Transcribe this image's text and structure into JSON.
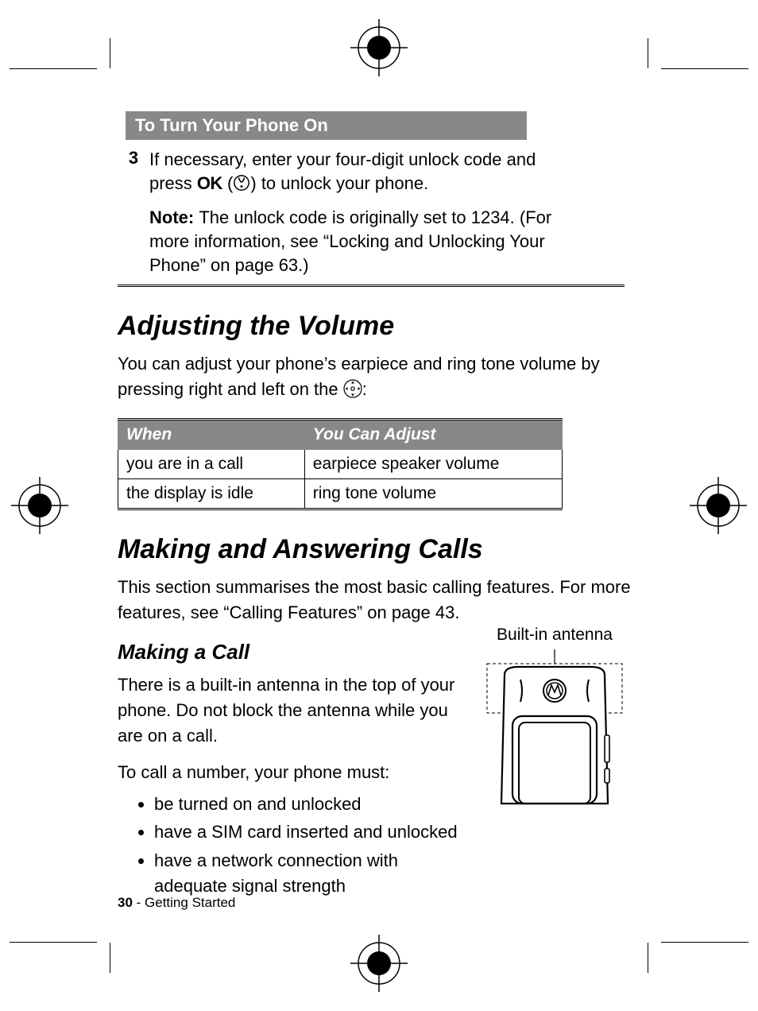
{
  "box": {
    "header": "To Turn Your Phone On",
    "step_number": "3",
    "step_text_a": "If necessary, enter your four-digit unlock code and press ",
    "ok_label": "OK",
    "step_text_b": " to unlock your phone.",
    "note_label": "Note: ",
    "note_text": "The unlock code is originally set to 1234. (For more information, see “Locking and Unlocking Your Phone” on page 63.)"
  },
  "volume": {
    "heading": "Adjusting the Volume",
    "intro_a": "You can adjust your phone’s earpiece and ring tone volume by pressing right and left on the ",
    "intro_b": ":",
    "col1": "When",
    "col2": "You Can Adjust",
    "rows": [
      {
        "when": "you are in a call",
        "adjust": "earpiece speaker volume"
      },
      {
        "when": "the display is idle",
        "adjust": "ring tone volume"
      }
    ]
  },
  "calls": {
    "heading": "Making and Answering Calls",
    "intro": "This section summarises the most basic calling features. For more features, see “Calling Features” on page 43.",
    "sub_heading": "Making a Call",
    "antenna_label": "Built-in antenna",
    "p1": "There is a built-in antenna in the top of your phone. Do not block the antenna while you are on a call.",
    "p2": "To call a number, your phone must:",
    "bullets": [
      "be turned on and unlocked",
      "have a SIM card inserted and unlocked",
      "have a network connection with adequate signal strength"
    ]
  },
  "footer": {
    "page_number": "30",
    "section": " - Getting Started"
  },
  "icons": {
    "softkey": "softkey-icon",
    "nav": "nav-key-icon",
    "reg_target": "registration-target-icon"
  }
}
